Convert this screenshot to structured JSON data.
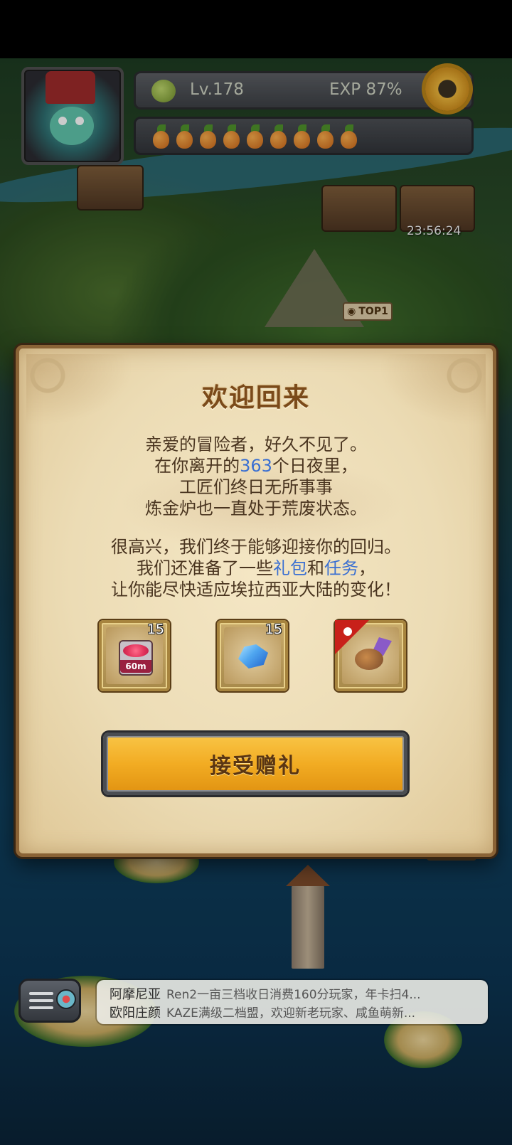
{
  "hud": {
    "level": "Lv.178",
    "exp": "EXP  87%",
    "energy_count": 9,
    "timer": "23:56:24",
    "top_badge": "TOP1"
  },
  "dialog": {
    "title": "欢迎回来",
    "para1": [
      "亲爱的冒险者，好久不见了。",
      {
        "pre": "在你离开的",
        "highlight": "363",
        "post": "个日夜里，"
      },
      "工匠们终日无所事事",
      "炼金炉也一直处于荒废状态。"
    ],
    "para2": [
      "很高兴，我们终于能够迎接你的回归。",
      {
        "pre": "我们还准备了一些",
        "h1": "礼包",
        "mid": "和",
        "h2": "任务",
        "post": "，"
      },
      "让你能尽快适应埃拉西亚大陆的变化！"
    ],
    "rewards": [
      {
        "icon": "time-box-icon",
        "label": "60m",
        "count": "15"
      },
      {
        "icon": "crystal-icon",
        "count": "15"
      },
      {
        "icon": "dragon-pet-icon",
        "count": ""
      }
    ],
    "accept_label": "接受赠礼",
    "highlight_color": "#3a6fd2"
  },
  "chat": {
    "messages": [
      {
        "name": "阿摩尼亚",
        "text": "Ren2一亩三档收日消费160分玩家，年卡扫4..."
      },
      {
        "name": "欧阳庄颜",
        "text": "KAZE满级二档盟，欢迎新老玩家、咸鱼萌新..."
      }
    ]
  }
}
